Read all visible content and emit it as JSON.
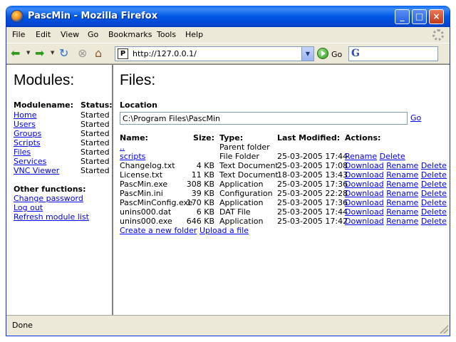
{
  "window": {
    "title": "PascMin - Mozilla Firefox"
  },
  "menu": [
    "File",
    "Edit",
    "View",
    "Go",
    "Bookmarks",
    "Tools",
    "Help"
  ],
  "toolbar": {
    "url": "http://127.0.0.1/",
    "favicon_text": "P",
    "go_label": "Go",
    "search_engine_glyph": "G"
  },
  "sidebar": {
    "heading": "Modules:",
    "col_name": "Modulename:",
    "col_status": "Status:",
    "modules": [
      {
        "name": "Home",
        "status": "Started"
      },
      {
        "name": "Users",
        "status": "Started"
      },
      {
        "name": "Groups",
        "status": "Started"
      },
      {
        "name": "Scripts",
        "status": "Started"
      },
      {
        "name": "Files",
        "status": "Started"
      },
      {
        "name": "Services",
        "status": "Started"
      },
      {
        "name": "VNC Viewer",
        "status": "Started"
      }
    ],
    "other_heading": "Other functions:",
    "other_links": [
      "Change password",
      "Log out",
      "Refresh module list"
    ]
  },
  "main": {
    "heading": "Files:",
    "location_label": "Location",
    "location_value": "C:\\Program Files\\PascMin",
    "location_go": "Go",
    "headers": {
      "name": "Name:",
      "size": "Size:",
      "type": "Type:",
      "modified": "Last Modified:",
      "actions": "Actions:"
    },
    "rows": [
      {
        "name": "..",
        "size": "",
        "type": "Parent folder",
        "modified": "",
        "actions": [],
        "is_link": true
      },
      {
        "name": "scripts",
        "size": "",
        "type": "File Folder",
        "modified": "25-03-2005 17:44",
        "actions": [
          "Rename",
          "Delete"
        ],
        "is_link": true
      },
      {
        "name": "Changelog.txt",
        "size": "4 KB",
        "type": "Text Document",
        "modified": "25-03-2005 17:08",
        "actions": [
          "Download",
          "Rename",
          "Delete"
        ],
        "is_link": false
      },
      {
        "name": "License.txt",
        "size": "11 KB",
        "type": "Text Document",
        "modified": "18-03-2005 13:43",
        "actions": [
          "Download",
          "Rename",
          "Delete"
        ],
        "is_link": false
      },
      {
        "name": "PascMin.exe",
        "size": "308 KB",
        "type": "Application",
        "modified": "25-03-2005 17:36",
        "actions": [
          "Download",
          "Rename",
          "Delete"
        ],
        "is_link": false
      },
      {
        "name": "PascMin.ini",
        "size": "39 KB",
        "type": "Configuration",
        "modified": "25-03-2005 22:28",
        "actions": [
          "Download",
          "Rename",
          "Delete"
        ],
        "is_link": false
      },
      {
        "name": "PascMinConfig.exe",
        "size": "170 KB",
        "type": "Application",
        "modified": "25-03-2005 17:36",
        "actions": [
          "Download",
          "Rename",
          "Delete"
        ],
        "is_link": false
      },
      {
        "name": "unins000.dat",
        "size": "6 KB",
        "type": "DAT File",
        "modified": "25-03-2005 17:44",
        "actions": [
          "Download",
          "Rename",
          "Delete"
        ],
        "is_link": false
      },
      {
        "name": "unins000.exe",
        "size": "646 KB",
        "type": "Application",
        "modified": "25-03-2005 17:42",
        "actions": [
          "Download",
          "Rename",
          "Delete"
        ],
        "is_link": false
      }
    ],
    "footer_links": [
      "Create a new folder",
      "Upload a file"
    ]
  },
  "status": {
    "text": "Done"
  }
}
